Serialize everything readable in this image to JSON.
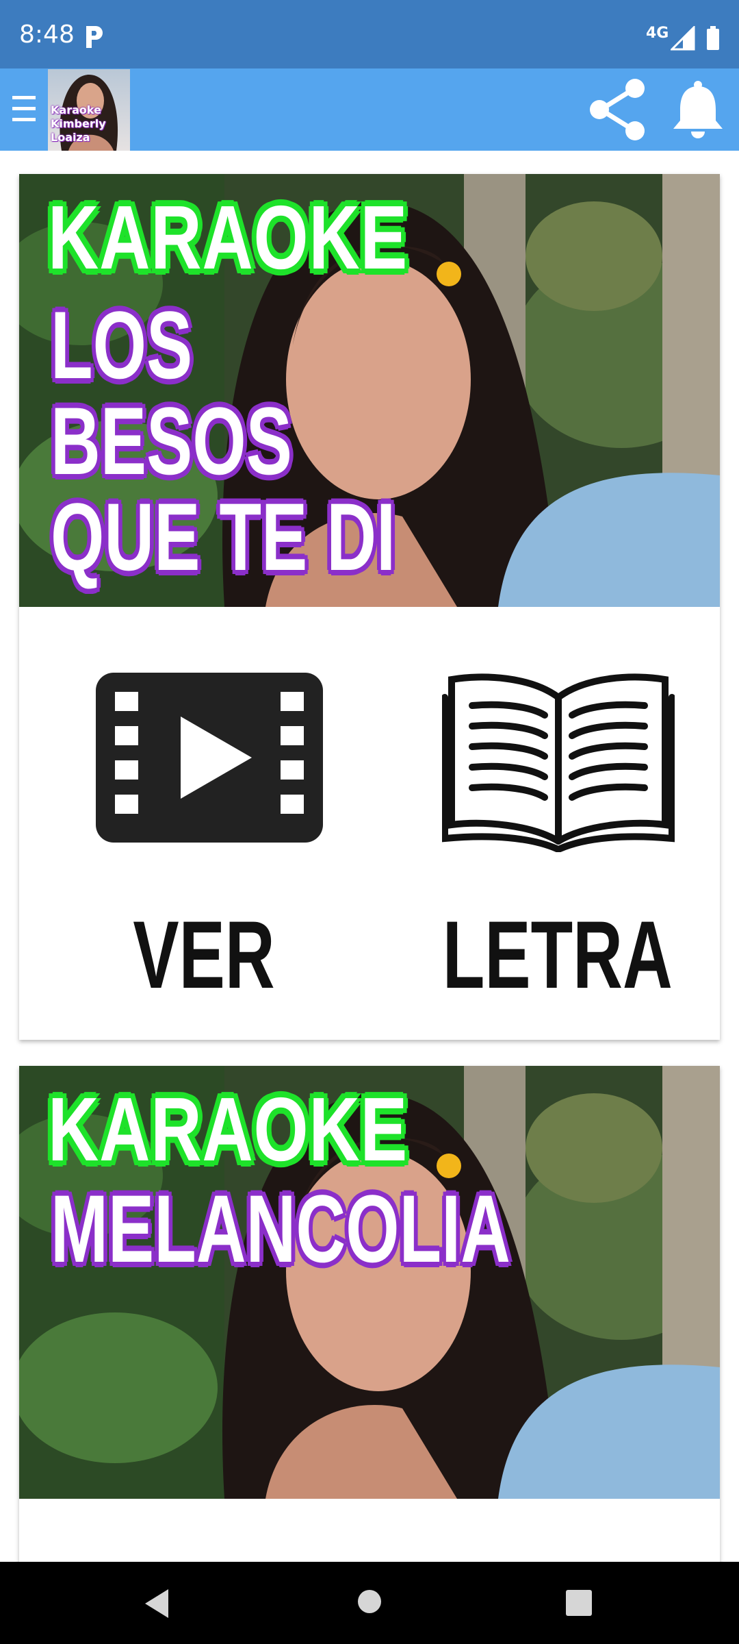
{
  "status_bar": {
    "time": "8:48",
    "network": "4G",
    "app_icon": "parking-p-icon",
    "signal_icon": "signal-icon",
    "battery_icon": "battery-icon"
  },
  "app_bar": {
    "menu_icon": "hamburger-menu-icon",
    "logo_text": "Karaoke\nKimberly\nLoaiza",
    "share_icon": "share-icon",
    "notification_icon": "bell-icon",
    "color": "#55a5ee"
  },
  "cards": [
    {
      "image_heading": "KARAOKE",
      "image_title": "LOS\nBESOS\nQUE TE DI",
      "ver_label": "VER",
      "letra_label": "LETRA"
    },
    {
      "image_heading": "KARAOKE",
      "image_title": "MELANCOLIA"
    }
  ],
  "nav_bar": {
    "back_icon": "back-triangle-icon",
    "home_icon": "home-circle-icon",
    "recents_icon": "recents-square-icon"
  }
}
